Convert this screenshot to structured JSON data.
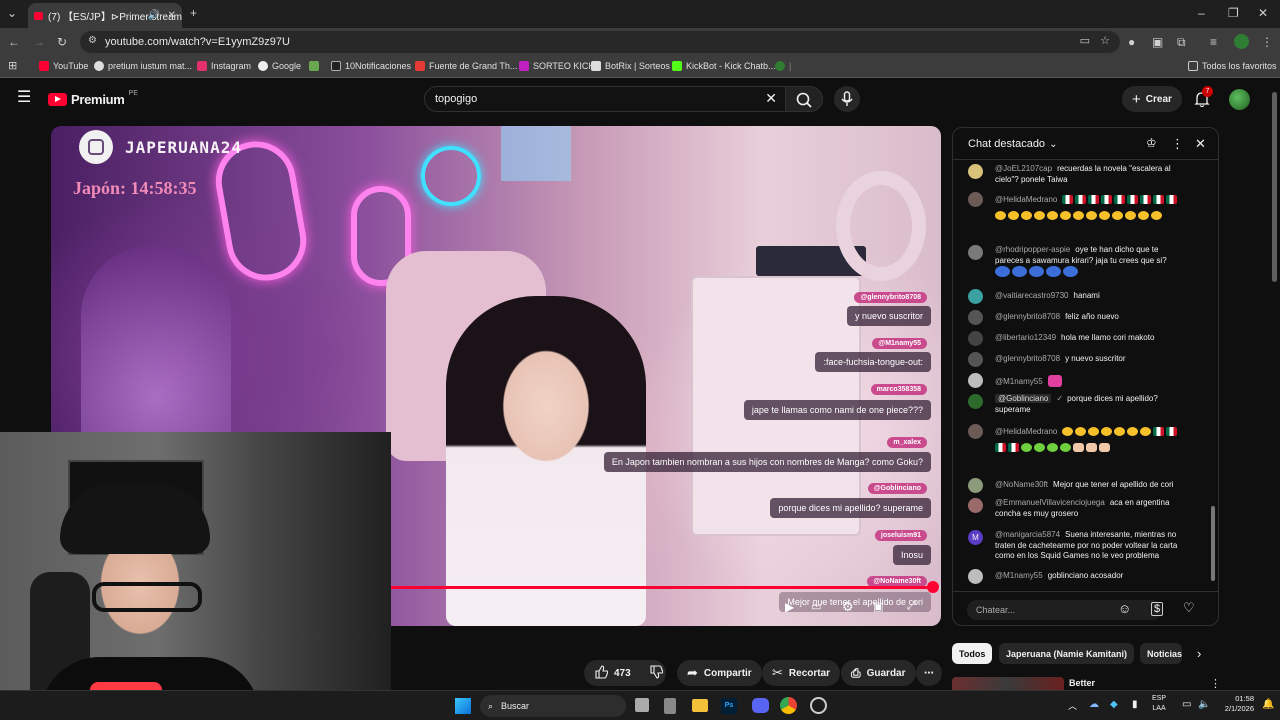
{
  "browser": {
    "tab_title": "(7) 【ES/JP】⊳Primer stream",
    "url": "youtube.com/watch?v=E1yymZ9z97U",
    "bookmarks": [
      "YouTube",
      "pretium iustum mat...",
      "Instagram",
      "Google",
      "10Notificaciones",
      "Fuente de Grand Th...",
      "SORTEO KICK",
      "BotRix | Sorteos",
      "KickBot - Kick Chatb...",
      "Todos los favoritos"
    ]
  },
  "youtube": {
    "logo_text": "Premium",
    "logo_region": "PE",
    "search_value": "topogigo",
    "create_label": "Crear",
    "notification_count": "7"
  },
  "video": {
    "overlay_handle": "JAPERUANA24",
    "overlay_clock": "Japón: 14:58:35",
    "onscreen_chat": [
      {
        "name": "@glennybrito8708",
        "msg": "y nuevo suscritor"
      },
      {
        "name": "@M1namy55",
        "msg": ":face-fuchsia-tongue-out:"
      },
      {
        "name": "marco358358",
        "msg": "jape te llamas como nami de one piece???"
      },
      {
        "name": "m_xalex",
        "msg": "En Japon tambien nombran a sus hijos con nombres de Manga? como Goku?"
      },
      {
        "name": "@Goblinciano",
        "msg": "porque dices mi apellido? superame"
      },
      {
        "name": "joseluism91",
        "msg": "Inosu"
      },
      {
        "name": "@NoName30ft",
        "msg": "Mejor que tener el apellido de cori"
      }
    ],
    "progress": 0.995
  },
  "actions": {
    "likes": "473",
    "share": "Compartir",
    "clip": "Recortar",
    "save": "Guardar"
  },
  "chat": {
    "title": "Chat destacado",
    "input_placeholder": "Chatear...",
    "messages": [
      {
        "author": "@JoEL2107cap",
        "text": "recuerdas la novela \"escalera al cielo\"? ponele Taiwa",
        "color": "#d9c27a"
      },
      {
        "author": "@HelidaMedrano",
        "text": "",
        "color": "#6b5a55"
      },
      {
        "author": "@rhodripopper-aspie",
        "text": "oye te han dicho que te pareces a sawamura kirari? jaja tu crees que si?",
        "color": "#7a7a7a"
      },
      {
        "author": "@vaitiarecastro9730",
        "text": "hanami",
        "color": "#3aa0a0"
      },
      {
        "author": "@glennybrito8708",
        "text": "feliz año nuevo",
        "color": "#555555"
      },
      {
        "author": "@libertario12349",
        "text": "hola me llamo cori makoto",
        "color": "#444444"
      },
      {
        "author": "@glennybrito8708",
        "text": "y nuevo suscritor",
        "color": "#555555"
      },
      {
        "author": "@M1namy55",
        "text": "",
        "color": "#bdbdbd"
      },
      {
        "author": "@Goblinciano",
        "text": "porque dices mi apellido? superame",
        "color": "#2d6b2d"
      },
      {
        "author": "@HelidaMedrano",
        "text": "",
        "color": "#6b5a55"
      },
      {
        "author": "@NoName30ft",
        "text": "Mejor que tener el apellido de cori",
        "color": "#8a9a7a"
      },
      {
        "author": "@EmmanuelVillavicenciojuega",
        "text": "aca en argentina concha es muy grosero",
        "color": "#9a6a6a"
      },
      {
        "author": "@manigarcia5874",
        "text": "Suena interesante, mientras no traten de cachetearme por no poder voltear la carta como en los Squid Games no le veo problema",
        "color": "#5b3cc4"
      },
      {
        "author": "@M1namy55",
        "text": "goblinciano acosador",
        "color": "#bdbdbd"
      }
    ]
  },
  "chips": [
    "Todos",
    "Japeruana (Namie Kamitani)",
    "Noticias"
  ],
  "recommended_title": "Better",
  "taskbar": {
    "search_label": "Buscar",
    "lang_line1": "ESP",
    "lang_line2": "LAA",
    "time": "01:58",
    "date": "2/1/2026"
  },
  "colors": {
    "accent": "#ff0033",
    "bg": "#0f0f0f",
    "pill": "#272727"
  }
}
